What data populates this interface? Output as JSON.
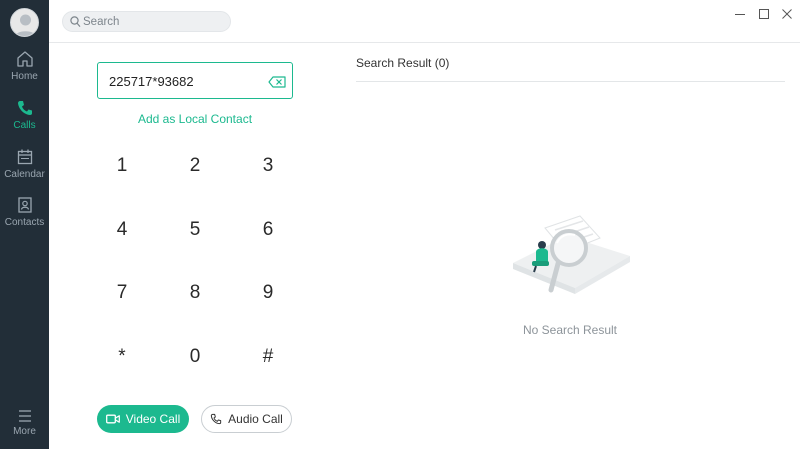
{
  "sidebar": {
    "items": [
      {
        "label": "Home",
        "icon": "home-icon"
      },
      {
        "label": "Calls",
        "icon": "phone-icon",
        "active": true
      },
      {
        "label": "Calendar",
        "icon": "calendar-icon"
      },
      {
        "label": "Contacts",
        "icon": "contacts-icon"
      }
    ],
    "more": {
      "label": "More",
      "icon": "menu-icon"
    }
  },
  "search": {
    "placeholder": "Search",
    "value": ""
  },
  "dialer": {
    "number": "225717*93682",
    "add_contact_label": "Add as Local Contact",
    "keys": [
      "1",
      "2",
      "3",
      "4",
      "5",
      "6",
      "7",
      "8",
      "9",
      "*",
      "0",
      "#"
    ],
    "video_call_label": "Video Call",
    "audio_call_label": "Audio Call"
  },
  "results": {
    "title": "Search Result (0)",
    "empty_text": "No Search Result"
  },
  "colors": {
    "accent": "#1cb98f",
    "sidebar_bg": "#222e38",
    "sidebar_text": "#9aa6b0"
  }
}
